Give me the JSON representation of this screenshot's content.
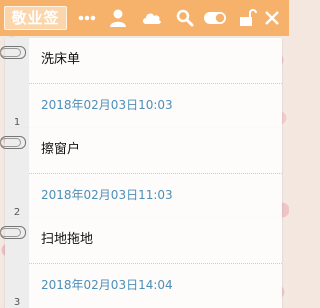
{
  "toolbar": {
    "brand": "敬业签",
    "icons": [
      "more-icon",
      "user-icon",
      "cloud-icon",
      "search-icon",
      "toggle-icon",
      "lock-icon",
      "close-icon"
    ]
  },
  "notes": [
    {
      "index": "1",
      "title": "洗床单",
      "time": "2018年02月03日10:03"
    },
    {
      "index": "2",
      "title": "擦窗户",
      "time": "2018年02月03日11:03"
    },
    {
      "index": "3",
      "title": "扫地拖地",
      "time": "2018年02月03日14:04"
    }
  ],
  "colors": {
    "accent": "#f6b16b",
    "time_text": "#4d8fb8"
  }
}
